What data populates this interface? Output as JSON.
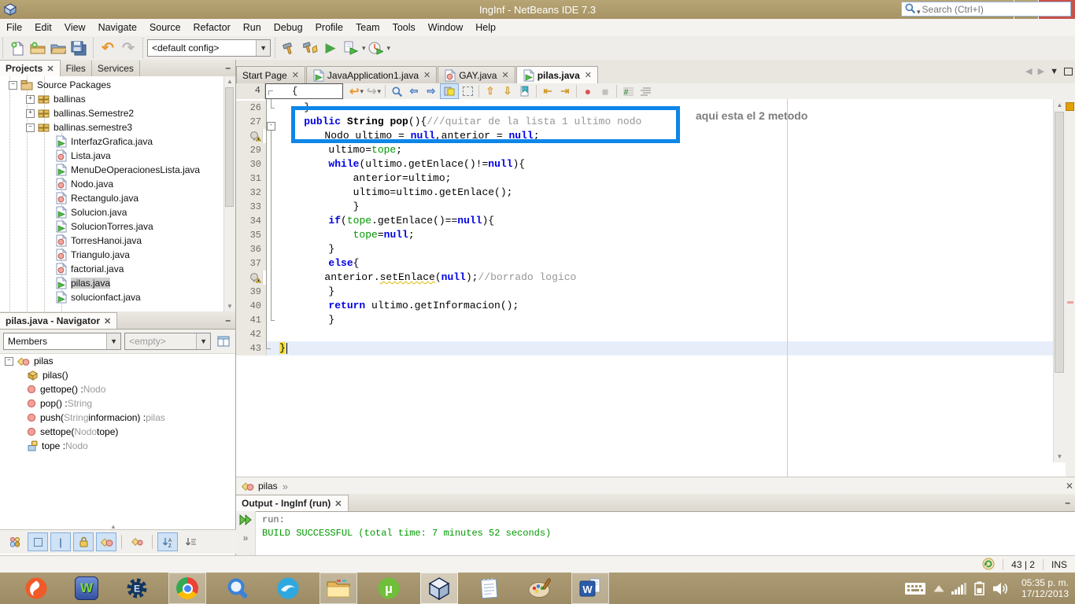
{
  "window": {
    "title": "IngInf - NetBeans IDE 7.3"
  },
  "menubar": [
    "File",
    "Edit",
    "View",
    "Navigate",
    "Source",
    "Refactor",
    "Run",
    "Debug",
    "Profile",
    "Team",
    "Tools",
    "Window",
    "Help"
  ],
  "quick_search": {
    "placeholder": "Search (Ctrl+I)"
  },
  "main_toolbar": {
    "config_value": "<default config>",
    "groups": [
      [
        "new-file",
        "new-project",
        "open-project",
        "save-all"
      ],
      [
        "undo",
        "redo"
      ],
      [
        "config-combo"
      ],
      [
        "build",
        "clean-build",
        "run",
        "debug",
        "profile"
      ]
    ]
  },
  "projects_panel": {
    "tabs": [
      "Projects",
      "Files",
      "Services"
    ],
    "active_tab": "Projects",
    "tree": [
      {
        "lvl": 2,
        "exp": "-",
        "icon": "package-root",
        "label": "Source Packages"
      },
      {
        "lvl": 3,
        "exp": "+",
        "icon": "package",
        "label": "ballinas"
      },
      {
        "lvl": 3,
        "exp": "+",
        "icon": "package",
        "label": "ballinas.Semestre2"
      },
      {
        "lvl": 3,
        "exp": "-",
        "icon": "package",
        "label": "ballinas.semestre3"
      },
      {
        "lvl": 4,
        "icon": "java-main-file",
        "label": "InterfazGrafica.java"
      },
      {
        "lvl": 4,
        "icon": "java-class-file",
        "label": "Lista.java"
      },
      {
        "lvl": 4,
        "icon": "java-main-file",
        "label": "MenuDeOperacionesLista.java"
      },
      {
        "lvl": 4,
        "icon": "java-class-file",
        "label": "Nodo.java"
      },
      {
        "lvl": 4,
        "icon": "java-class-file",
        "label": "Rectangulo.java"
      },
      {
        "lvl": 4,
        "icon": "java-main-file",
        "label": "Solucion.java"
      },
      {
        "lvl": 4,
        "icon": "java-main-file",
        "label": "SolucionTorres.java"
      },
      {
        "lvl": 4,
        "icon": "java-class-file",
        "label": "TorresHanoi.java"
      },
      {
        "lvl": 4,
        "icon": "java-class-file",
        "label": "Triangulo.java"
      },
      {
        "lvl": 4,
        "icon": "java-class-file",
        "label": "factorial.java"
      },
      {
        "lvl": 4,
        "icon": "java-main-file",
        "label": "pilas.java",
        "selected": true
      },
      {
        "lvl": 4,
        "icon": "java-main-file",
        "label": "solucionfact.java"
      }
    ]
  },
  "navigator": {
    "title": "pilas.java - Navigator",
    "members_filter": "Members",
    "inspect_value": "<empty>",
    "members": [
      {
        "lvl": 0,
        "exp": "-",
        "icon": "nav-class",
        "t": [
          [
            "pilas",
            "d"
          ]
        ]
      },
      {
        "lvl": 1,
        "icon": "nav-constructor",
        "t": [
          [
            "pilas()",
            "d"
          ]
        ]
      },
      {
        "lvl": 1,
        "icon": "nav-method",
        "t": [
          [
            "gettope() : ",
            "d"
          ],
          [
            "Nodo",
            "ty"
          ]
        ]
      },
      {
        "lvl": 1,
        "icon": "nav-method",
        "t": [
          [
            "pop() : ",
            "d"
          ],
          [
            "String",
            "ty"
          ]
        ]
      },
      {
        "lvl": 1,
        "icon": "nav-method",
        "t": [
          [
            "push(",
            "d"
          ],
          [
            "String",
            "ty"
          ],
          [
            " informacion) : ",
            "d"
          ],
          [
            "pilas",
            "ty"
          ]
        ]
      },
      {
        "lvl": 1,
        "icon": "nav-method",
        "t": [
          [
            "settope(",
            "d"
          ],
          [
            "Nodo",
            "ty"
          ],
          [
            " tope)",
            "d"
          ]
        ]
      },
      {
        "lvl": 1,
        "icon": "nav-field",
        "t": [
          [
            "tope : ",
            "d"
          ],
          [
            "Nodo",
            "ty"
          ]
        ]
      }
    ],
    "filter_buttons": [
      {
        "name": "show-inherited",
        "toggled": false
      },
      {
        "name": "show-fields",
        "toggled": true
      },
      {
        "name": "show-static",
        "toggled": true
      },
      {
        "name": "show-non-public",
        "toggled": true
      },
      {
        "name": "show-inner-classes",
        "toggled": true
      },
      {
        "name": "filter-state",
        "toggled": false
      },
      {
        "name": "sort-alphabetically",
        "toggled": true
      },
      {
        "name": "sort-by-source",
        "toggled": false
      }
    ]
  },
  "editor": {
    "tabs": [
      {
        "label": "Start Page",
        "icon": null
      },
      {
        "label": "JavaApplication1.java",
        "icon": "java-main-file"
      },
      {
        "label": "GAY.java",
        "icon": "java-class-file"
      },
      {
        "label": "pilas.java",
        "icon": "java-main-file",
        "active": true
      }
    ],
    "fold_hint": {
      "line": "4",
      "text": "{"
    },
    "toolbar_groups": [
      [
        "back",
        "forward"
      ],
      [
        "find",
        "prev-occurrence",
        "next-occurrence",
        "highlight-occurrences",
        "rect-selection"
      ],
      [
        "prev-bookmark",
        "next-bookmark",
        "toggle-bookmark"
      ],
      [
        "shift-left",
        "shift-right"
      ],
      [
        "record-macro",
        "stop-macro"
      ],
      [
        "comment",
        "uncomment"
      ]
    ],
    "annotation_note": "aqui esta el 2 metodo",
    "breadcrumb": "pilas",
    "code": [
      {
        "n": 26,
        "t": [
          [
            "    }",
            "d"
          ]
        ]
      },
      {
        "n": 27,
        "t": [
          [
            "    ",
            "d"
          ],
          [
            "public ",
            "k"
          ],
          [
            "String ",
            "b"
          ],
          [
            "pop",
            "b"
          ],
          [
            "(){",
            "d"
          ],
          [
            "///quitar de la lista 1 ultimo nodo",
            "c"
          ]
        ]
      },
      {
        "n": 28,
        "warn": true,
        "t": [
          [
            "        ",
            "d"
          ],
          [
            "Nodo ultimo = ",
            "d"
          ],
          [
            "null",
            "kw"
          ],
          [
            ",anterior = ",
            "d"
          ],
          [
            "null",
            "k"
          ],
          [
            ";",
            "d"
          ]
        ]
      },
      {
        "n": 29,
        "t": [
          [
            "        ultimo=",
            "d"
          ],
          [
            "tope",
            "g"
          ],
          [
            ";",
            "d"
          ]
        ]
      },
      {
        "n": 30,
        "t": [
          [
            "        ",
            "d"
          ],
          [
            "while",
            "k"
          ],
          [
            "(ultimo.getEnlace()!=",
            "d"
          ],
          [
            "null",
            "k"
          ],
          [
            "){",
            "d"
          ]
        ]
      },
      {
        "n": 31,
        "t": [
          [
            "            anterior=ultimo;",
            "d"
          ]
        ]
      },
      {
        "n": 32,
        "t": [
          [
            "            ultimo=ultimo.getEnlace();",
            "d"
          ]
        ]
      },
      {
        "n": 33,
        "t": [
          [
            "            }",
            "d"
          ]
        ]
      },
      {
        "n": 34,
        "t": [
          [
            "        ",
            "d"
          ],
          [
            "if",
            "k"
          ],
          [
            "(",
            "d"
          ],
          [
            "tope",
            "g"
          ],
          [
            ".getEnlace()==",
            "d"
          ],
          [
            "null",
            "k"
          ],
          [
            "){",
            "d"
          ]
        ]
      },
      {
        "n": 35,
        "t": [
          [
            "            ",
            "d"
          ],
          [
            "tope",
            "g"
          ],
          [
            "=",
            "d"
          ],
          [
            "null",
            "k"
          ],
          [
            ";",
            "d"
          ]
        ]
      },
      {
        "n": 36,
        "t": [
          [
            "        }",
            "d"
          ]
        ]
      },
      {
        "n": 37,
        "t": [
          [
            "        ",
            "d"
          ],
          [
            "else",
            "k"
          ],
          [
            "{",
            "d"
          ]
        ]
      },
      {
        "n": 38,
        "warn": true,
        "t": [
          [
            "        anterior.",
            "d"
          ],
          [
            "setEnlace",
            "w"
          ],
          [
            "(",
            "d"
          ],
          [
            "null",
            "k"
          ],
          [
            ");",
            "d"
          ],
          [
            "//borrado logico",
            "c"
          ]
        ]
      },
      {
        "n": 39,
        "t": [
          [
            "        }",
            "d"
          ]
        ]
      },
      {
        "n": 40,
        "t": [
          [
            "        ",
            "d"
          ],
          [
            "return ",
            "k"
          ],
          [
            "ultimo.getInformacion();",
            "d"
          ]
        ]
      },
      {
        "n": 41,
        "t": [
          [
            "        }",
            "d"
          ]
        ]
      },
      {
        "n": 42,
        "t": []
      },
      {
        "n": 43,
        "cur": true,
        "t": [
          [
            "}",
            "y"
          ]
        ]
      }
    ]
  },
  "output": {
    "title": "Output - IngInf (run)",
    "lines": [
      {
        "text": "run:",
        "style": "plain"
      },
      {
        "text": "BUILD SUCCESSFUL (total time: 7 minutes 52 seconds)",
        "style": "success"
      }
    ]
  },
  "status_bar": {
    "caret_position": "43 | 2",
    "insert_mode": "INS"
  },
  "taskbar": {
    "apps": [
      {
        "name": "origin",
        "active": false
      },
      {
        "name": "wartune",
        "active": false
      },
      {
        "name": "cheat-engine",
        "active": false
      },
      {
        "name": "chrome",
        "active": true
      },
      {
        "name": "search-app",
        "active": false
      },
      {
        "name": "blue-swirl-app",
        "active": false
      },
      {
        "name": "file-explorer",
        "active": true
      },
      {
        "name": "utorrent",
        "active": false
      },
      {
        "name": "netbeans",
        "active": true,
        "focused": true
      },
      {
        "name": "notepad",
        "active": false
      },
      {
        "name": "paint",
        "active": false
      },
      {
        "name": "word",
        "active": true
      }
    ],
    "tray": [
      "touch-keyboard",
      "hidden-icons",
      "network",
      "battery",
      "volume"
    ],
    "clock": {
      "time": "05:35 p. m.",
      "date": "17/12/2013"
    }
  }
}
